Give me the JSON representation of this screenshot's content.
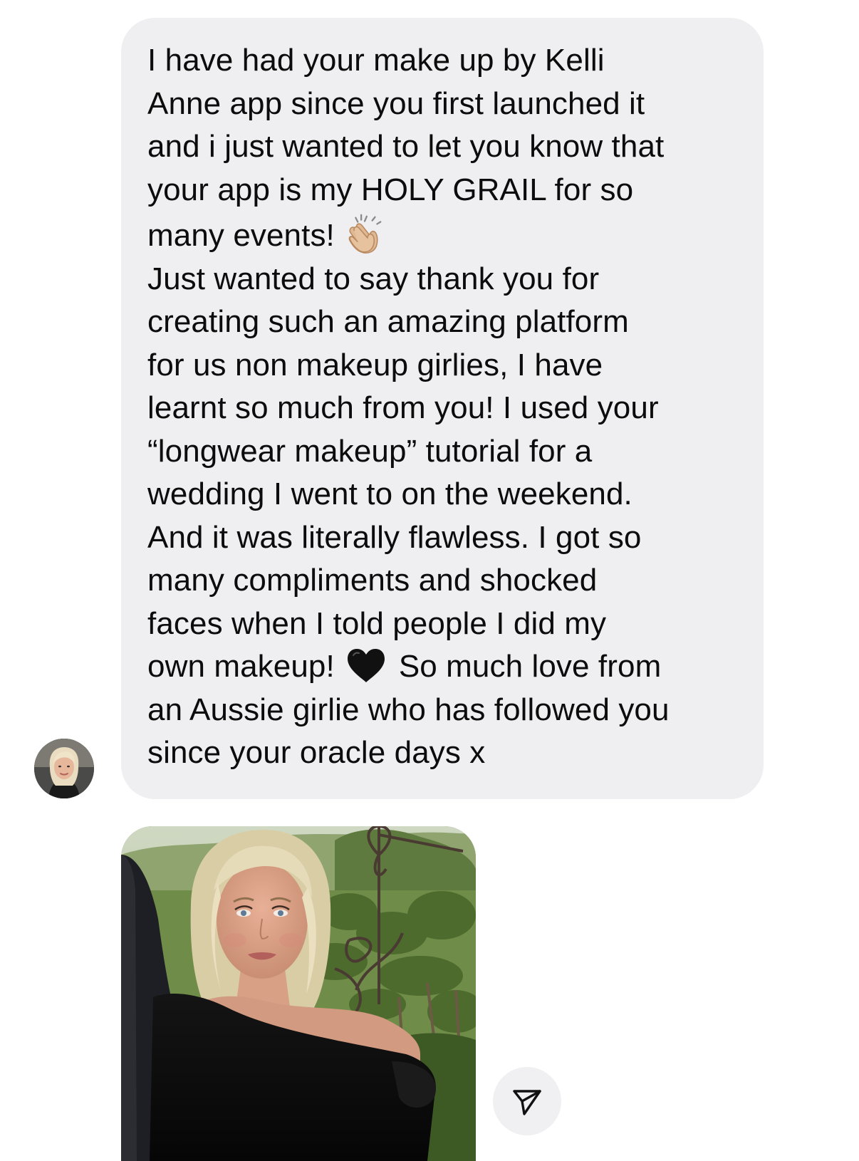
{
  "conversation": {
    "message": {
      "lines": [
        "I have had your make up by Kelli",
        "Anne app since you first launched it",
        "and i just wanted to let you know that",
        "your app is my HOLY GRAIL for so",
        "many events!",
        "Just wanted to say thank you for",
        "creating such an amazing platform",
        "for us non makeup girlies, I have",
        "learnt so much from you! I used your",
        "“longwear makeup” tutorial for a",
        "wedding I went to on the weekend.",
        "And it was literally flawless. I got so",
        "many compliments and shocked",
        "faces when I told people I did my",
        "own makeup!",
        "So much love from",
        "an Aussie girlie who has followed you",
        "since your oracle days x"
      ],
      "emojis": {
        "after_line_5": "clapping-hands-icon",
        "after_line_15": "black-heart-icon"
      },
      "bubble_color": "#efeff1",
      "text_color": "#0c0c0c"
    },
    "sender": {
      "avatar": "avatar"
    },
    "attachment": {
      "type": "photo"
    },
    "actions": {
      "share_icon": "send-icon"
    }
  }
}
